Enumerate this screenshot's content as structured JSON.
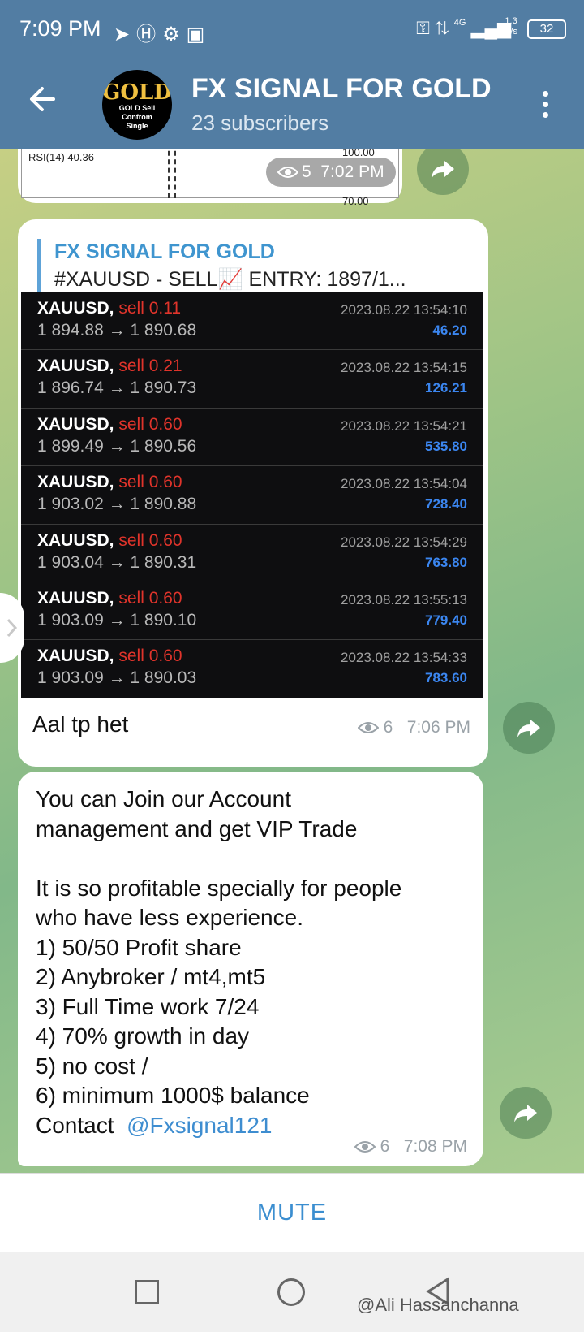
{
  "status_bar": {
    "time": "7:09 PM",
    "network": "4G",
    "speed_value": "1.3",
    "speed_unit": "K/s",
    "battery": "32"
  },
  "header": {
    "avatar_title": "GOLD",
    "avatar_line1": "GOLD Sell",
    "avatar_line2": "Confrom",
    "avatar_line3": "Single",
    "title": "FX SIGNAL FOR GOLD",
    "subtitle": "23 subscribers"
  },
  "prev_post": {
    "rsi_label": "RSI(14) 40.36",
    "axis_top": "100.00",
    "axis_bottom": "70.00",
    "views": "5",
    "time": "7:02 PM"
  },
  "signal_post": {
    "reply_title": "FX SIGNAL FOR GOLD",
    "reply_text": "#XAUUSD   - SELL📈      ENTRY:  1897/1...",
    "trades": [
      {
        "symbol": "XAUUSD,",
        "side": "sell 0.11",
        "prices": "1 894.88 → 1 890.68",
        "datetime": "2023.08.22 13:54:10",
        "profit": "46.20"
      },
      {
        "symbol": "XAUUSD,",
        "side": "sell 0.21",
        "prices": "1 896.74 → 1 890.73",
        "datetime": "2023.08.22 13:54:15",
        "profit": "126.21"
      },
      {
        "symbol": "XAUUSD,",
        "side": "sell 0.60",
        "prices": "1 899.49 → 1 890.56",
        "datetime": "2023.08.22 13:54:21",
        "profit": "535.80"
      },
      {
        "symbol": "XAUUSD,",
        "side": "sell 0.60",
        "prices": "1 903.02 → 1 890.88",
        "datetime": "2023.08.22 13:54:04",
        "profit": "728.40"
      },
      {
        "symbol": "XAUUSD,",
        "side": "sell 0.60",
        "prices": "1 903.04 → 1 890.31",
        "datetime": "2023.08.22 13:54:29",
        "profit": "763.80"
      },
      {
        "symbol": "XAUUSD,",
        "side": "sell 0.60",
        "prices": "1 903.09 → 1 890.10",
        "datetime": "2023.08.22 13:55:13",
        "profit": "779.40"
      },
      {
        "symbol": "XAUUSD,",
        "side": "sell 0.60",
        "prices": "1 903.09 → 1 890.03",
        "datetime": "2023.08.22 13:54:33",
        "profit": "783.60"
      }
    ],
    "caption": "Aal tp het",
    "views": "6",
    "time": "7:06 PM"
  },
  "promo_post": {
    "lines": [
      "You can Join our Account",
      "management and get VIP Trade",
      "",
      "It is so profitable specially for people",
      "who have less experience.",
      "1) 50/50 Profit share",
      "2) Anybroker / mt4,mt5",
      "3) Full Time work 7/24",
      "4) 70% growth in day",
      "5) no cost /",
      "6) minimum 1000$ balance"
    ],
    "contact_label": "Contact",
    "contact_handle": "@Fxsignal121",
    "views": "6",
    "time": "7:08 PM"
  },
  "mute_label": "MUTE",
  "watermark": "@Ali Hassanchanna",
  "colors": {
    "header": "#527da3",
    "link": "#3e8dd0",
    "sell": "#e0342b",
    "profit": "#3b86f0"
  }
}
